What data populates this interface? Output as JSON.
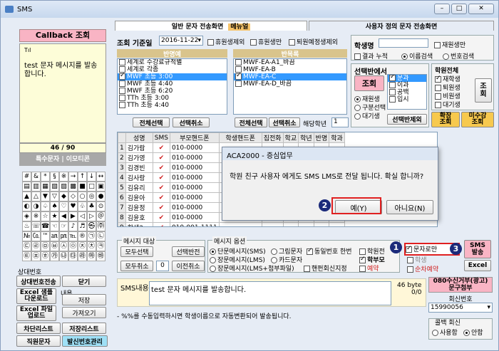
{
  "window": {
    "title": "SMS",
    "min": "–",
    "max": "□",
    "close": "✕"
  },
  "left": {
    "callback_title": "Callback 조회",
    "signal": "Tıl",
    "message": "test 문자 메시지를 발송합니다.",
    "counter": "46 / 90",
    "special_label": "특수문자 | 이모티콘",
    "symbols": [
      "#",
      "&",
      "*",
      "§",
      "※",
      "→",
      "↑",
      "↓",
      "↔",
      "▤",
      "▥",
      "▦",
      "▧",
      "▨",
      "▩",
      "■",
      "□",
      "▣",
      "▲",
      "△",
      "▼",
      "▽",
      "◆",
      "◇",
      "○",
      "◎",
      "●",
      "◐",
      "◑",
      "♤",
      "♠",
      "♡",
      "♥",
      "♧",
      "♣",
      "⊙",
      "◈",
      "※",
      "☆",
      "★",
      "◀",
      "▶",
      "◁",
      "▷",
      "＠",
      "♨",
      "☏",
      "☎",
      "☜",
      "☞",
      "♪",
      "♬",
      "㉿",
      "㈜",
      "№",
      "㏇",
      "™",
      "㏂",
      "㏘",
      "℡",
      "®",
      "㉠",
      "㉡",
      "㉢",
      "㉣",
      "㉤",
      "㉥",
      "㉦",
      "㉧",
      "㉨",
      "㉩",
      "㉪",
      "㉫",
      "㉬",
      "㉭",
      "㉮",
      "㉯",
      "㉰",
      "㉱",
      "㉲",
      "㉳",
      "㉴",
      "㉵",
      "㉶",
      "㉷",
      "㉸",
      "㉹",
      "㉺",
      "㉻",
      "♪",
      "♬"
    ],
    "receiver_label": "상대번호",
    "btn_all": "상대번호전송",
    "btn_close": "닫기",
    "btn_sample": "Excel 샘플\n다운로드",
    "content_label": "내용",
    "btn_save": "저장",
    "btn_upload": "Excel 파일\n업로드",
    "btn_load": "가져오기",
    "btn_blocklist": "차단리스트",
    "btn_savelist": "저장리스트",
    "btn_staff": "직원문자",
    "btn_sendnum": "발신번호관리"
  },
  "tabs": {
    "general": "일반 문자 전송화면",
    "badge": "메뉴얼",
    "custom": "사용자 정의 문자 전송화면"
  },
  "filters": {
    "date_label": "조회 기준일",
    "date_value": "2016-11-22",
    "opt1": "휴원생제외",
    "opt2": "휴원생만",
    "opt3": "퇴원예정생제외",
    "class_header": "반명예",
    "class_header2": "반목록",
    "classes_left": [
      "세계로 수강료규적별",
      "세계로 각종",
      "MWF 초등 3:00",
      "MWF 초등 4:40",
      "MWF 초등 6:20",
      "TTh 초등 3:00",
      "TTh 초등 4:40"
    ],
    "classes_right": [
      "MWF-EA-A1_바끔",
      "MWF-EA-B",
      "MWF-EA-C",
      "MWF-EA-D_바끔"
    ],
    "btn_select_all": "전체선택",
    "btn_deselect": "선택취소",
    "btn_select_all2": "전체선택",
    "btn_deselect2": "선택취소",
    "grade_label": "해당학년",
    "grade_value": "1"
  },
  "student_search": {
    "name_label": "학생명",
    "only_in": "재원생만",
    "result_cum": "결과 누적",
    "by_name": "이름검색",
    "by_num": "번호검색"
  },
  "class_select": {
    "title": "선택반에서",
    "btn_lookup": "조회",
    "r1": "재원생",
    "r2": "구분선택",
    "r3": "대기생",
    "items": [
      "문과",
      "이과",
      "공백",
      "입시"
    ],
    "btn_deselect": "선택반제외"
  },
  "academy": {
    "title": "학원전체",
    "o1": "재학생",
    "o2": "퇴원생",
    "o3": "비원생",
    "o4": "대기생",
    "btn_lookup": "조\n회",
    "btn_expand": "확장\n조회",
    "btn_nopay": "미수강\n조회"
  },
  "table": {
    "headers": [
      "성명",
      "SMS",
      "부모핸드폰",
      "학생핸드폰",
      "집전화",
      "학교",
      "학년",
      "반명",
      "학과"
    ],
    "rows": [
      {
        "no": "1",
        "name": "김가람",
        "sms": "✔",
        "phone": "010-0000"
      },
      {
        "no": "2",
        "name": "김가영",
        "sms": "✔",
        "phone": "010-0000"
      },
      {
        "no": "3",
        "name": "김경빈",
        "sms": "✔",
        "phone": "010-0000"
      },
      {
        "no": "4",
        "name": "김사랑",
        "sms": "✔",
        "phone": "010-0000"
      },
      {
        "no": "5",
        "name": "김유리",
        "sms": "✔",
        "phone": "010-0000"
      },
      {
        "no": "6",
        "name": "김윤아",
        "sms": "✔",
        "phone": "010-0000"
      },
      {
        "no": "7",
        "name": "김윤정",
        "sms": "✔",
        "phone": "010-0000"
      },
      {
        "no": "8",
        "name": "김윤호",
        "sms": "✔",
        "phone": "010-0000"
      },
      {
        "no": "9",
        "name": "학생3",
        "sms": "✔",
        "phone": "010-001-1111"
      }
    ]
  },
  "message_target": {
    "title": "메시지 대상",
    "btn_all": "모두선택",
    "btn_invert": "선택반전",
    "btn_clear": "모두취소",
    "count": "0",
    "btn_prev": "이전취소"
  },
  "message_options": {
    "title": "메시지 옵션",
    "sms": "단문메시지(SMS)",
    "graphic": "그림문자",
    "same": "동일번호 한번",
    "lms": "장문메시지(LMS)",
    "card": "카드문자",
    "parent": "학부모",
    "acad": "학원전",
    "mms": "장문메시지(LMS+첨부파일)",
    "handset": "핸펀회신지정",
    "reserve": "예약",
    "student": "학생",
    "seq": "순차예약",
    "text_only": "문자로만",
    "btn_send": "SMS\n발송",
    "btn_excel": "Excel"
  },
  "sms_content": {
    "label": "SMS내용",
    "text": "test 문자 메시지를 발송합니다.",
    "bytes": "46 byte",
    "pages": "0/0",
    "note": "- %%를 수동입력하시면 학생이름으로 자동변환되어 발송됩니다."
  },
  "right_bottom": {
    "reject": "080수신거부(광고)\n문구첨부",
    "reply_label": "회신번호",
    "reply_value": "15990056",
    "recall_title": "콜백 회신",
    "use": "사용함",
    "not_use": "안함"
  },
  "dialog": {
    "title": "ACA2000 - 증심업무",
    "message": "학원 친구 사용자 에게도 SMS LMS로 전달 됩니다. 확실 합니까?",
    "yes": "예(Y)",
    "no": "아니요(N)"
  },
  "callouts": {
    "c1": "1",
    "c2": "2",
    "c3": "3"
  }
}
